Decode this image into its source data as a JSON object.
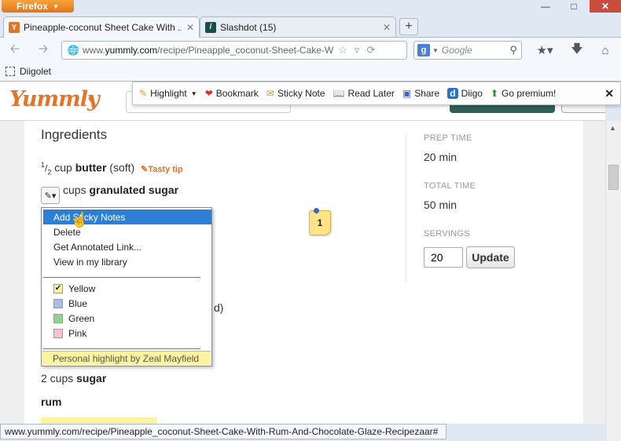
{
  "window": {
    "menu_label": "Firefox",
    "controls": {
      "minimize": "—",
      "maximize": "□",
      "close": "✕"
    }
  },
  "tabs": [
    {
      "label": "Pineapple-coconut Sheet Cake With ...",
      "icon": "yummly-favicon",
      "close": "✕"
    },
    {
      "label": "Slashdot (15)",
      "icon": "slashdot-favicon",
      "close": "✕"
    }
  ],
  "new_tab": "+",
  "nav": {
    "url_prefix": "www.",
    "url_domain": "yummly.com",
    "url_path": "/recipe/Pineapple_coconut-Sheet-Cake-W",
    "search_placeholder": "Google"
  },
  "bookmarks_bar": {
    "item": "Diigolet"
  },
  "diigo_toolbar": {
    "buttons": [
      "Highlight",
      "Bookmark",
      "Sticky Note",
      "Read Later",
      "Share",
      "Diigo",
      "Go premium!"
    ],
    "close": "✕"
  },
  "recipe": {
    "heading": "Ingredients",
    "ing1": {
      "num": "1",
      "den": "2",
      "unit": "cup",
      "name": "butter",
      "note": "(soft)",
      "tip": "Tasty tip"
    },
    "ing2": {
      "rest": "cups",
      "name": "granulated sugar"
    },
    "partial_text": "d)",
    "ing3": {
      "qty": "2 cups",
      "name": "sugar"
    },
    "ing4": {
      "name": "rum"
    }
  },
  "sidebar": {
    "prep_label": "PREP TIME",
    "prep_value": "20 min",
    "total_label": "TOTAL TIME",
    "total_value": "50 min",
    "servings_label": "SERVINGS",
    "servings_value": "20",
    "update_label": "Update"
  },
  "context_menu": {
    "items": [
      "Add Sticky Notes",
      "Delete",
      "Get Annotated Link...",
      "View in my library"
    ],
    "colors": [
      {
        "label": "Yellow",
        "swatch": "#fbf3a0",
        "checked": true
      },
      {
        "label": "Blue",
        "swatch": "#a9bfe6",
        "checked": false
      },
      {
        "label": "Green",
        "swatch": "#8fd68a",
        "checked": false
      },
      {
        "label": "Pink",
        "swatch": "#f7c2cc",
        "checked": false
      }
    ],
    "footer": "Personal highlight by Zeal Mayfield"
  },
  "sticky_note": {
    "count": "1"
  },
  "status_url": "www.yummly.com/recipe/Pineapple_coconut-Sheet-Cake-With-Rum-And-Chocolate-Glaze-Recipezaar#"
}
